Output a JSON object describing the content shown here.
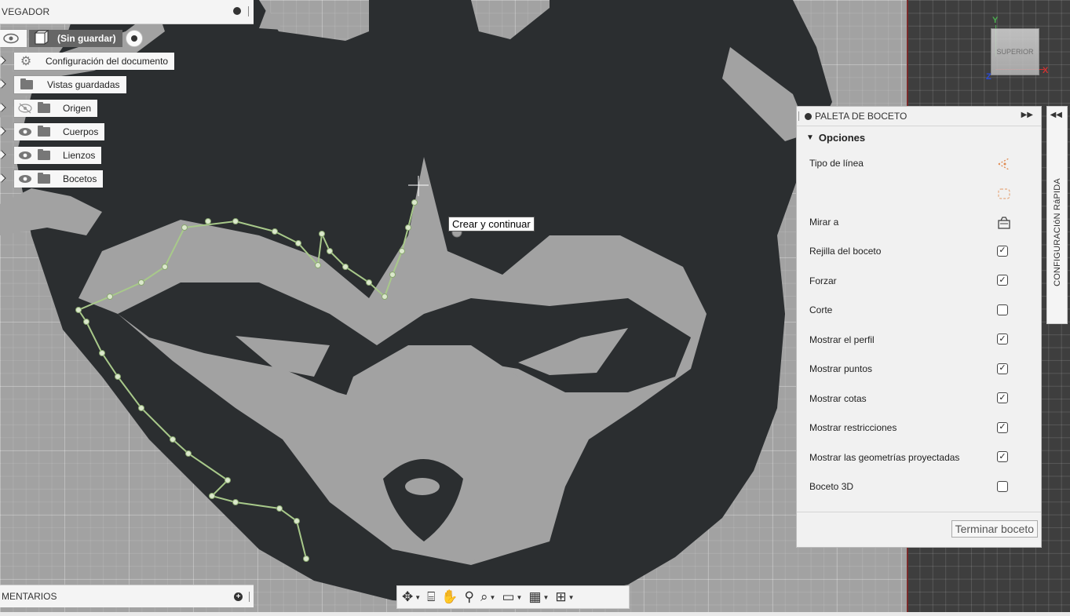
{
  "browser": {
    "title": "VEGADOR",
    "root_label": "(Sin guardar)",
    "items": [
      {
        "label": "Configuración del documento",
        "icon": "gear-icon"
      },
      {
        "label": "Vistas guardadas",
        "icon": "folder-icon"
      },
      {
        "label": "Origen",
        "icon": "folder-icon",
        "visible": false
      },
      {
        "label": "Cuerpos",
        "icon": "folder-icon",
        "visible": true
      },
      {
        "label": "Lienzos",
        "icon": "folder-icon",
        "visible": true
      },
      {
        "label": "Bocetos",
        "icon": "folder-icon",
        "visible": true
      }
    ]
  },
  "comments": {
    "title": "MENTARIOS"
  },
  "canvas": {
    "tooltip": "Crear y continuar"
  },
  "viewcube": {
    "face": "SUPERIOR",
    "axis_y": "Y",
    "axis_z": "Z",
    "axis_x": "X"
  },
  "palette": {
    "title": "PALETA DE BOCETO",
    "section": "Opciones",
    "options": [
      {
        "label": "Tipo de línea",
        "control": "icon",
        "icon": "linetype-icon"
      },
      {
        "label": "",
        "control": "icon",
        "icon": "slice-outline-icon"
      },
      {
        "label": "Mirar a",
        "control": "icon",
        "icon": "look-at-icon"
      },
      {
        "label": "Rejilla del boceto",
        "control": "checkbox",
        "checked": true
      },
      {
        "label": "Forzar",
        "control": "checkbox",
        "checked": true
      },
      {
        "label": "Corte",
        "control": "checkbox",
        "checked": false
      },
      {
        "label": "Mostrar el perfil",
        "control": "checkbox",
        "checked": true
      },
      {
        "label": "Mostrar puntos",
        "control": "checkbox",
        "checked": true
      },
      {
        "label": "Mostrar cotas",
        "control": "checkbox",
        "checked": true
      },
      {
        "label": "Mostrar restricciones",
        "control": "checkbox",
        "checked": true
      },
      {
        "label": "Mostrar las geometrías proyectadas",
        "control": "checkbox",
        "checked": true
      },
      {
        "label": "Boceto 3D",
        "control": "checkbox",
        "checked": false
      }
    ],
    "finish_button": "Terminar boceto"
  },
  "quick_config": {
    "label": "CONFIGURACIóN RáPIDA"
  },
  "toolbar": {
    "items": [
      "orbit-icon",
      "look-at-icon",
      "pan-icon",
      "zoom-icon",
      "fit-icon",
      "display-settings-icon",
      "grid-settings-icon",
      "viewports-icon"
    ]
  },
  "colors": {
    "accent_sketch": "#a8c98a",
    "artwork": "#2b2e30",
    "canvas": "#a2a2a2"
  }
}
